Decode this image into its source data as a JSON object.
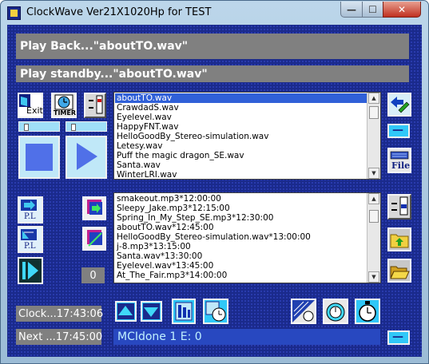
{
  "window": {
    "title": "ClockWave Ver21X1020Hp for TEST",
    "controls": {
      "minimize": "—",
      "maximize": "☐",
      "close": "✕"
    }
  },
  "status": {
    "playback": "Play Back...\"aboutTO.wav\"",
    "standby": "Play standby...\"aboutTO.wav\""
  },
  "buttons": {
    "exit_label": "Exit",
    "timer_label": "TIMER",
    "file_label": "File",
    "pl_label": "P.L",
    "counter": "0",
    "minus": "—"
  },
  "wav_list": {
    "items": [
      "aboutTO.wav",
      "CrawdadS.wav",
      "Eyelevel.wav",
      "HappyFNT.wav",
      "HelloGoodBy_Stereo-simulation.wav",
      "Letesy.wav",
      "Puff the magic dragon_SE.wav",
      "Santa.wav",
      "WinterLRI.wav"
    ],
    "selected": "aboutTO.wav"
  },
  "schedule_list": {
    "items": [
      "smakeout.mp3*12:00:00",
      "Sleepy_Jake.mp3*12:15:00",
      "Spring_In_My_Step_SE.mp3*12:30:00",
      "aboutTO.wav*12:45:00",
      "HelloGoodBy_Stereo-simulation.wav*13:00:00",
      "j-8.mp3*13:15:00",
      "Santa.wav*13:30:00",
      "Eyelevel.wav*13:45:00",
      "At_The_Fair.mp3*14:00:00"
    ]
  },
  "clock": {
    "current": "Clock...17:43:06",
    "next": "Next ...17:45:00"
  },
  "mci_status": "MCIdone  1 E: 0",
  "colors": {
    "client_bg": "#1a2a8c",
    "selected": "#3060d8",
    "status_bar": "#808080",
    "accent_cyan": "#40d8f8"
  }
}
